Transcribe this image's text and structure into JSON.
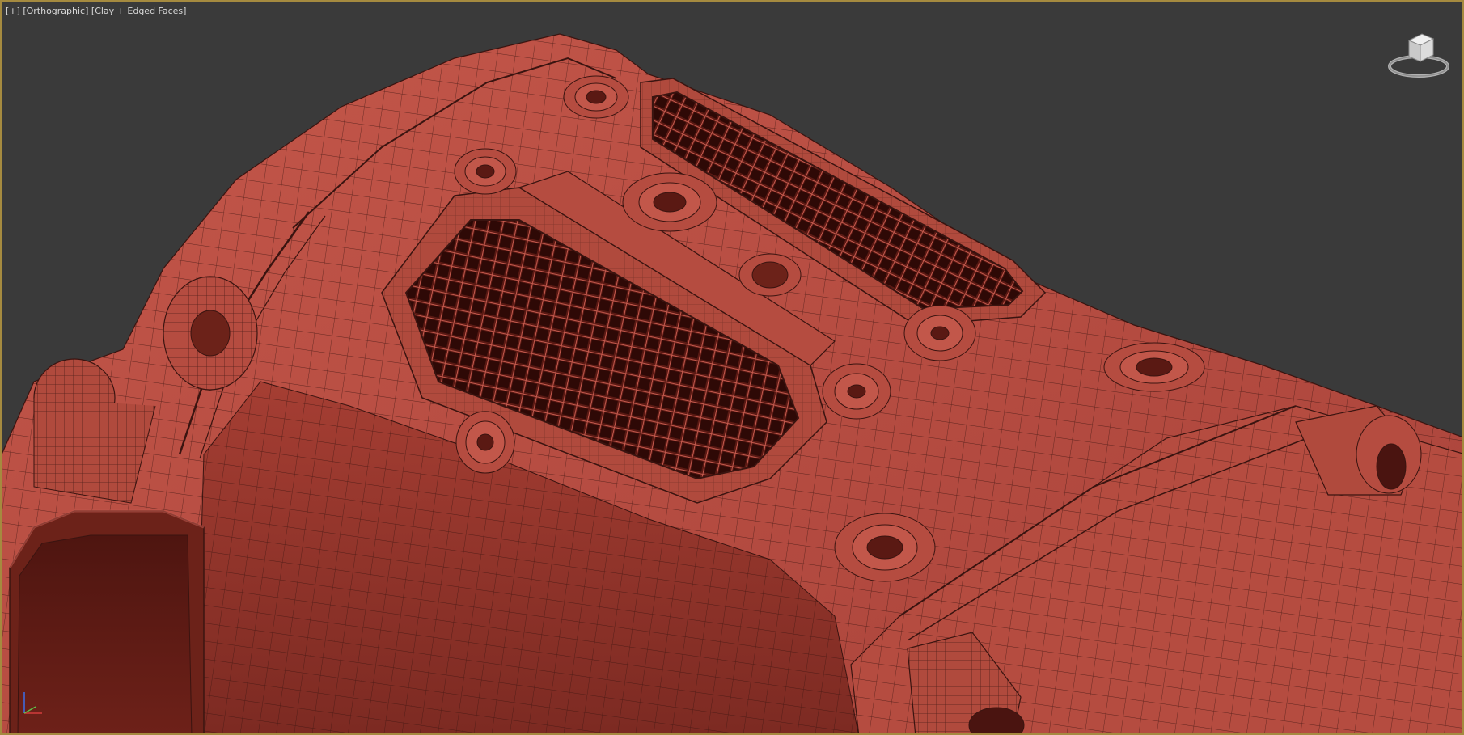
{
  "viewport": {
    "label_parts": [
      "[+]",
      "[Orthographic]",
      "[Clay + Edged Faces]"
    ],
    "border_color": "#a58a3f",
    "background_color": "#3a3a3a"
  },
  "viewcube": {
    "icon": "viewcube-icon"
  },
  "axis_tripod": {
    "icon": "axis-tripod-icon",
    "axes": [
      "x",
      "y",
      "z"
    ]
  },
  "model": {
    "shading": "Clay + Edged Faces",
    "clay_color": "#b24a3e",
    "wire_color": "#3a1410"
  }
}
